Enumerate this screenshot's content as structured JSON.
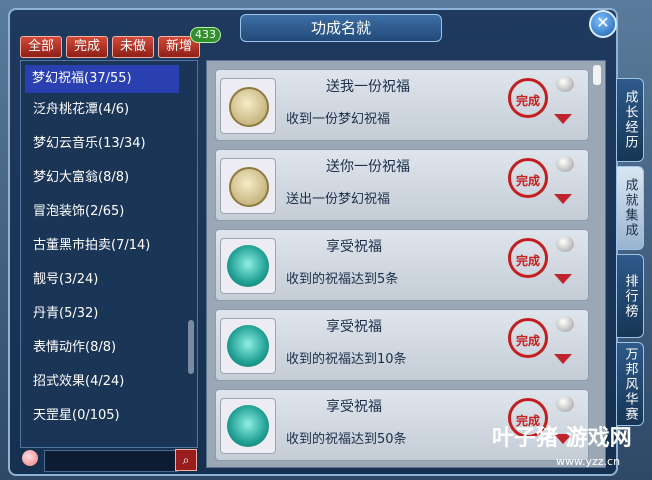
{
  "window": {
    "title": "功成名就"
  },
  "filters": [
    {
      "label": "全部"
    },
    {
      "label": "完成"
    },
    {
      "label": "未做"
    },
    {
      "label": "新增"
    }
  ],
  "new_count": "433",
  "categories": [
    {
      "label": "梦幻祝福(37/55)"
    },
    {
      "label": "泛舟桃花潭(4/6)"
    },
    {
      "label": "梦幻云音乐(13/34)"
    },
    {
      "label": "梦幻大富翁(8/8)"
    },
    {
      "label": "冒泡装饰(2/65)"
    },
    {
      "label": "古董黑市拍卖(7/14)"
    },
    {
      "label": "靓号(3/24)"
    },
    {
      "label": "丹青(5/32)"
    },
    {
      "label": "表情动作(8/8)"
    },
    {
      "label": "招式效果(4/24)"
    },
    {
      "label": "天罡星(0/105)"
    }
  ],
  "achievements": [
    {
      "title": "送我一份祝福",
      "desc": "收到一份梦幻祝福",
      "icon": "coin-icon",
      "stamp": "完成"
    },
    {
      "title": "送你一份祝福",
      "desc": "送出一份梦幻祝福",
      "icon": "coin-icon",
      "stamp": "完成"
    },
    {
      "title": "享受祝福",
      "desc": "收到的祝福达到5条",
      "icon": "flower-icon",
      "stamp": "完成"
    },
    {
      "title": "享受祝福",
      "desc": "收到的祝福达到10条",
      "icon": "flower-icon",
      "stamp": "完成"
    },
    {
      "title": "享受祝福",
      "desc": "收到的祝福达到50条",
      "icon": "flower-icon",
      "stamp": "完成"
    }
  ],
  "side_tabs": [
    {
      "label": "成长经历"
    },
    {
      "label": "成就集成"
    },
    {
      "label": "排行榜"
    },
    {
      "label": "万邦风华赛"
    }
  ],
  "search": {
    "placeholder": ""
  },
  "watermark": {
    "main": "叶子猪 游戏网",
    "sub": "www.yzz.cn"
  }
}
